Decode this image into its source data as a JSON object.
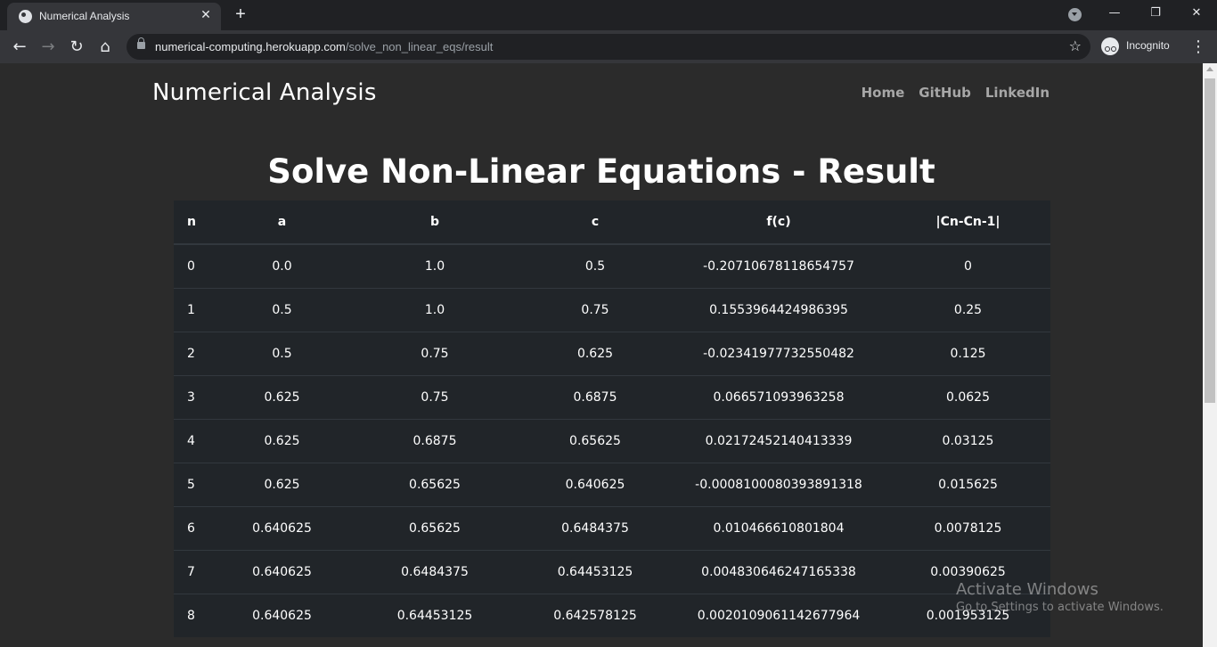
{
  "browser": {
    "tab_title": "Numerical Analysis",
    "tab_close": "✕",
    "new_tab": "+",
    "url_host": "numerical-computing.herokuapp.com",
    "url_path": "/solve_non_linear_eqs/result",
    "incognito_label": "Incognito",
    "window_controls": {
      "minimize": "—",
      "restore": "❐",
      "close": "✕"
    },
    "nav": {
      "back": "←",
      "forward": "→",
      "reload": "↻",
      "home": "⌂",
      "star": "☆",
      "menu": "⋮"
    }
  },
  "page": {
    "brand": "Numerical Analysis",
    "nav_links": [
      "Home",
      "GitHub",
      "LinkedIn"
    ],
    "title": "Solve Non-Linear Equations - Result"
  },
  "table": {
    "headers": [
      "n",
      "a",
      "b",
      "c",
      "f(c)",
      "|Cn-Cn-1|"
    ],
    "rows": [
      [
        "0",
        "0.0",
        "1.0",
        "0.5",
        "-0.20710678118654757",
        "0"
      ],
      [
        "1",
        "0.5",
        "1.0",
        "0.75",
        "0.1553964424986395",
        "0.25"
      ],
      [
        "2",
        "0.5",
        "0.75",
        "0.625",
        "-0.02341977732550482",
        "0.125"
      ],
      [
        "3",
        "0.625",
        "0.75",
        "0.6875",
        "0.066571093963258",
        "0.0625"
      ],
      [
        "4",
        "0.625",
        "0.6875",
        "0.65625",
        "0.02172452140413339",
        "0.03125"
      ],
      [
        "5",
        "0.625",
        "0.65625",
        "0.640625",
        "-0.0008100080393891318",
        "0.015625"
      ],
      [
        "6",
        "0.640625",
        "0.65625",
        "0.6484375",
        "0.010466610801804",
        "0.0078125"
      ],
      [
        "7",
        "0.640625",
        "0.6484375",
        "0.64453125",
        "0.004830646247165338",
        "0.00390625"
      ],
      [
        "8",
        "0.640625",
        "0.64453125",
        "0.642578125",
        "0.0020109061142677964",
        "0.001953125"
      ]
    ]
  },
  "watermark": {
    "title": "Activate Windows",
    "subtitle": "Go to Settings to activate Windows."
  }
}
